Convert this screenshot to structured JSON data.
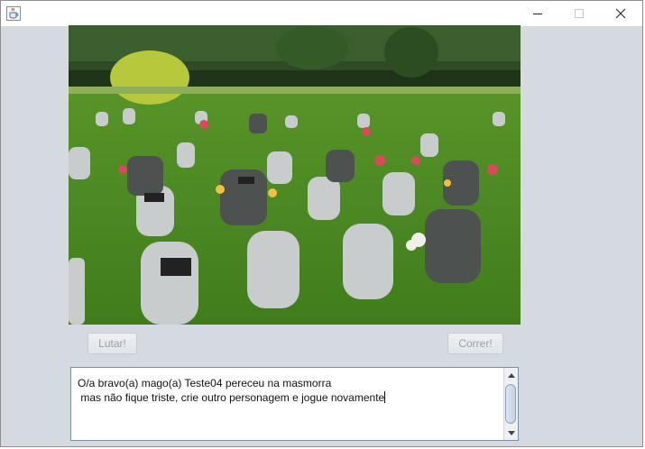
{
  "window": {
    "controls": {
      "minimize_icon": "minimize-icon",
      "maximize_icon": "maximize-icon",
      "close_icon": "close-icon"
    },
    "app_icon": "java-cup-icon"
  },
  "scene": {
    "image": "cemetery-photo"
  },
  "buttons": {
    "fight_label": "Lutar!",
    "run_label": "Correr!"
  },
  "log": {
    "lines": [
      "O/a bravo(a) mago(a) Teste04 pereceu na masmorra",
      " mas não fique triste, crie outro personagem e jogue novamente"
    ]
  },
  "colors": {
    "window_bg": "#d5d9e0",
    "textarea_border": "#7a8fa8",
    "disabled_text": "#9aa0a8"
  }
}
